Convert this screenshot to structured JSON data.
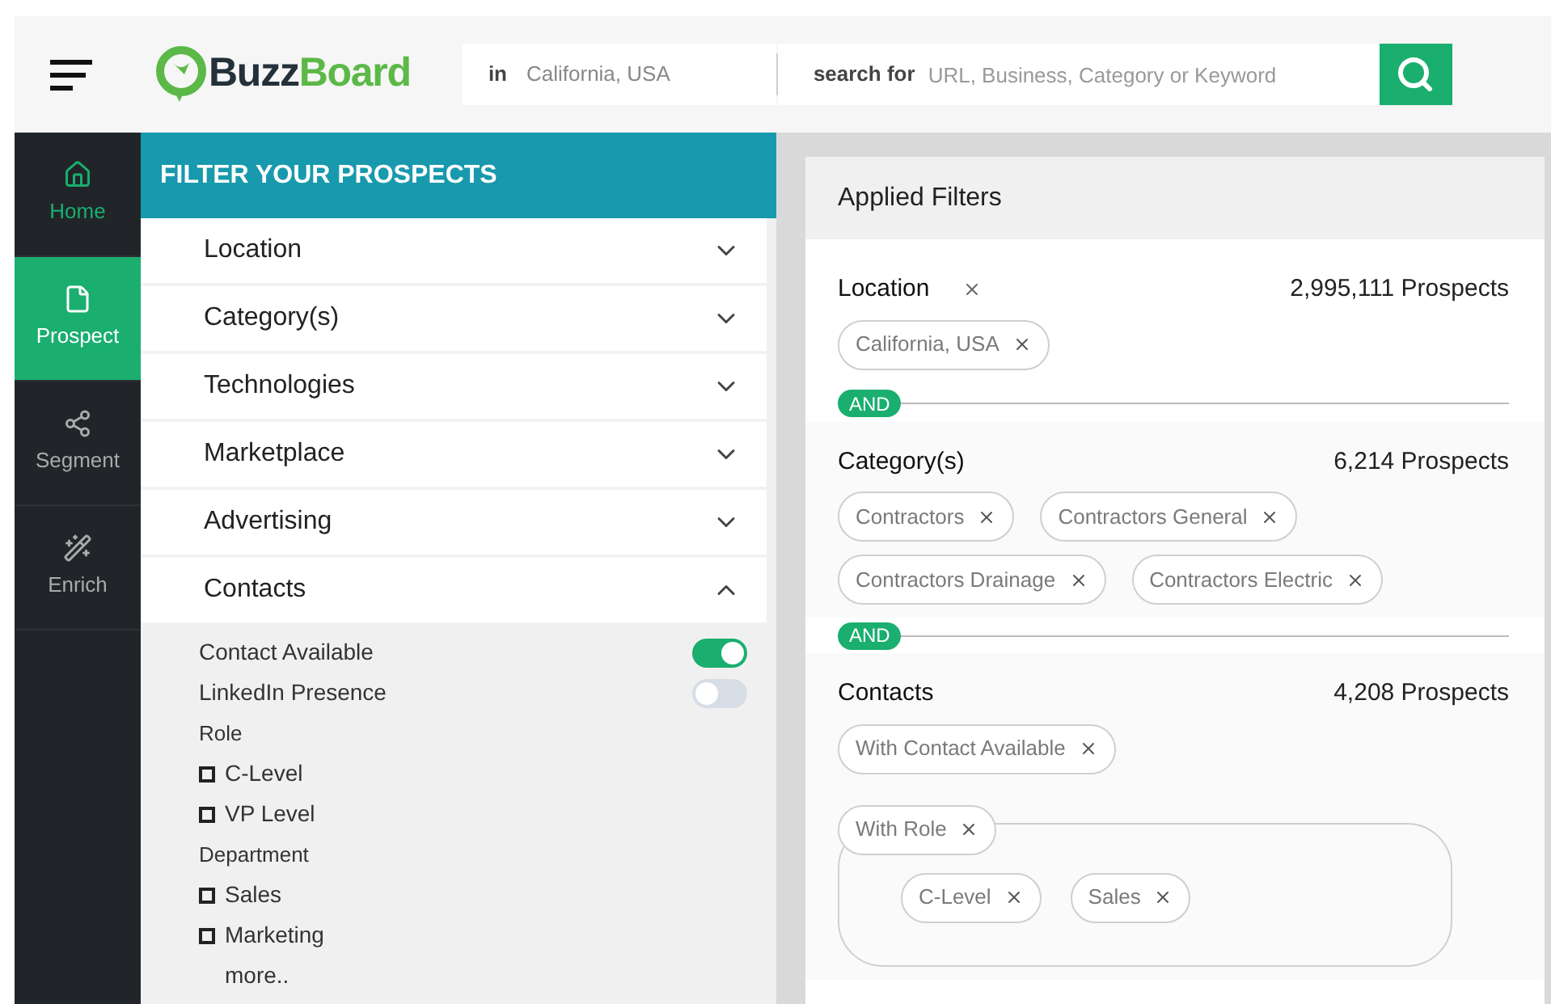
{
  "header": {
    "logo": {
      "part_1": "Buzz",
      "part_2": "Board"
    },
    "location": {
      "label": "in",
      "value": "California, USA"
    },
    "query": {
      "label": "search for",
      "placeholder": "URL, Business, Category or Keyword"
    }
  },
  "nav": {
    "items": [
      {
        "label": "Home",
        "selected": false
      },
      {
        "label": "Prospect",
        "selected": true
      },
      {
        "label": "Segment",
        "selected": false
      },
      {
        "label": "Enrich",
        "selected": false
      }
    ]
  },
  "filter_panel": {
    "title": "FILTER YOUR PROSPECTS",
    "sections": [
      {
        "label": "Location",
        "expanded": false
      },
      {
        "label": "Category(s)",
        "expanded": false
      },
      {
        "label": "Technologies",
        "expanded": false
      },
      {
        "label": "Marketplace",
        "expanded": false
      },
      {
        "label": "Advertising",
        "expanded": false
      },
      {
        "label": "Contacts",
        "expanded": true
      }
    ],
    "contact_options": [
      {
        "kind": "toggle",
        "label": "Contact Available",
        "on": true
      },
      {
        "kind": "toggle",
        "label": "LinkedIn Presence",
        "on": false
      },
      {
        "kind": "heading",
        "label": "Role"
      },
      {
        "kind": "checkbox",
        "label": "C-Level",
        "checked": false
      },
      {
        "kind": "checkbox",
        "label": "VP Level",
        "checked": false
      },
      {
        "kind": "heading",
        "label": "Department"
      },
      {
        "kind": "checkbox",
        "label": "Sales",
        "checked": false
      },
      {
        "kind": "checkbox",
        "label": "Marketing",
        "checked": false
      },
      {
        "kind": "link",
        "label": "more.."
      }
    ]
  },
  "applied_filters": {
    "title": "Applied Filters",
    "groups": [
      {
        "title": "Location",
        "removable": true,
        "count": "2,995,111 Prospects",
        "chips": [
          "California, USA"
        ]
      },
      {
        "joiner": "AND",
        "title": "Category(s)",
        "removable": false,
        "count": "6,214 Prospects",
        "chips": [
          "Contractors",
          "Contractors General",
          "Contractors Drainage",
          "Contractors Electric"
        ]
      },
      {
        "joiner": "AND",
        "title": "Contacts",
        "removable": false,
        "count": "4,208 Prospects",
        "chips": [
          "With Contact Available"
        ],
        "subgroup": {
          "label": "With Role",
          "chips": [
            "C-Level",
            "Sales"
          ]
        }
      }
    ]
  }
}
